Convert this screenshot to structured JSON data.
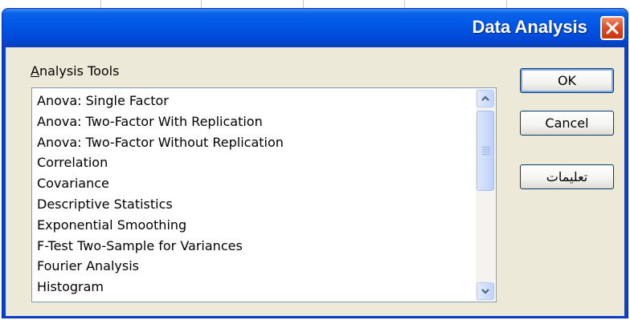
{
  "dialog": {
    "title": "Data Analysis",
    "group_label": "Analysis Tools",
    "group_label_accel": "A",
    "group_label_rest": "nalysis Tools"
  },
  "list": {
    "items": [
      "Anova: Single Factor",
      "Anova: Two-Factor With Replication",
      "Anova: Two-Factor Without Replication",
      "Correlation",
      "Covariance",
      "Descriptive Statistics",
      "Exponential Smoothing",
      "F-Test Two-Sample for Variances",
      "Fourier Analysis",
      "Histogram"
    ]
  },
  "buttons": {
    "ok": "OK",
    "cancel": "Cancel",
    "help": "تعليمات"
  },
  "colors": {
    "titlebar": "#0055e5",
    "close": "#dd4a21",
    "client": "#ece9d8"
  },
  "icons": {
    "close": "close-icon",
    "scroll_up": "chevron-up-icon",
    "scroll_down": "chevron-down-icon"
  }
}
